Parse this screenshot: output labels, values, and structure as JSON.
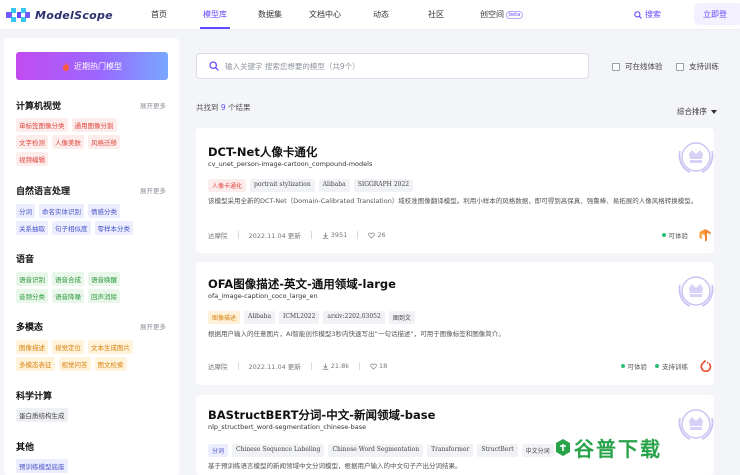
{
  "header": {
    "logo_text": "ModelScope",
    "nav": [
      "首页",
      "模型库",
      "数据集",
      "文档中心",
      "动态",
      "社区",
      "创空间"
    ],
    "active_nav": "模型库",
    "beta_badge": "beta",
    "search_label": "搜索",
    "login_label": "立即登"
  },
  "sidebar": {
    "hot_button": "近期热门模型",
    "more_label": "展开更多",
    "categories": [
      {
        "title": "计算机视觉",
        "has_more": true,
        "tag_rows": [
          [
            "单标签图像分类",
            "通用图像分割"
          ],
          [
            "文字检测",
            "人像美肤",
            "风格迁移"
          ],
          [
            "视频编辑"
          ]
        ]
      },
      {
        "title": "自然语言处理",
        "has_more": true,
        "tag_rows": [
          [
            "分词",
            "命名实体识别",
            "情感分类"
          ],
          [
            "关系抽取",
            "句子相似度",
            "零样本分类"
          ]
        ]
      },
      {
        "title": "语音",
        "has_more": false,
        "tag_rows": [
          [
            "语音识别",
            "语音合成",
            "语音唤醒"
          ],
          [
            "音频分类",
            "语音降噪",
            "回声消除"
          ]
        ]
      },
      {
        "title": "多模态",
        "has_more": true,
        "tag_rows": [
          [
            "图像描述",
            "视觉定位",
            "文本生成图片"
          ],
          [
            "多模态表征",
            "视觉问答",
            "图文检索"
          ]
        ]
      },
      {
        "title": "科学计算",
        "has_more": false,
        "tag_rows": [
          [
            "蛋白质结构生成"
          ]
        ]
      },
      {
        "title": "其他",
        "has_more": false,
        "tag_rows": [
          [
            "预训练模型底座"
          ]
        ]
      }
    ]
  },
  "search": {
    "placeholder": "输入关键字 搜索您想要的模型（共9个）",
    "filter_online": "可在线体验",
    "filter_train": "支持训练"
  },
  "results": {
    "prefix": "共找到",
    "count": "9",
    "suffix": "个结果",
    "sort_label": "综合排序"
  },
  "models": [
    {
      "title": "DCT-Net人像卡通化",
      "subtitle": "cv_unet_person-image-cartoon_compound-models",
      "tags": [
        "人像卡通化",
        "portrait stylization",
        "Alibaba",
        "SIGGRAPH 2022"
      ],
      "description": "该模型采用全新的DCT-Net（Domain-Calibrated Translation）域校准图像翻译模型。利用小样本的风格数据，即可得到高保真、强鲁棒、易拓展的人像风格转换模型。",
      "author": "达摩院",
      "updated": "2022.11.04 更新",
      "downloads": "3951",
      "likes": "26",
      "badges": [
        "可体验"
      ]
    },
    {
      "title": "OFA图像描述-英文-通用领域-large",
      "subtitle": "ofa_image-caption_coco_large_en",
      "tags": [
        "图像描述",
        "Alibaba",
        "ICML2022",
        "arxiv:2202.03052",
        "图到文"
      ],
      "description": "根据用户输入的任意图片，AI智能创作模型3秒内快速写出“一句话描述”，可用于图像标签和图像简介。",
      "author": "达摩院",
      "updated": "2022.11.04 更新",
      "downloads": "21.8k",
      "likes": "18",
      "badges": [
        "可体验",
        "支持训练"
      ]
    },
    {
      "title": "BAStructBERT分词-中文-新闻领域-base",
      "subtitle": "nlp_structbert_word-segmentation_chinese-base",
      "tags": [
        "分词",
        "Chinese Sequence Labeling",
        "Chinese Word Segmentation",
        "Transformer",
        "StructBert",
        "中文分词"
      ],
      "description": "基于预训练语言模型的新闻领域中文分词模型，根据用户输入的中文句子产出分词结果。"
    }
  ],
  "watermark": {
    "text": "谷普下载"
  },
  "colors": {
    "accent": "#624aff",
    "online_dot": "#2fbf71",
    "watermark": "#28a34a"
  }
}
